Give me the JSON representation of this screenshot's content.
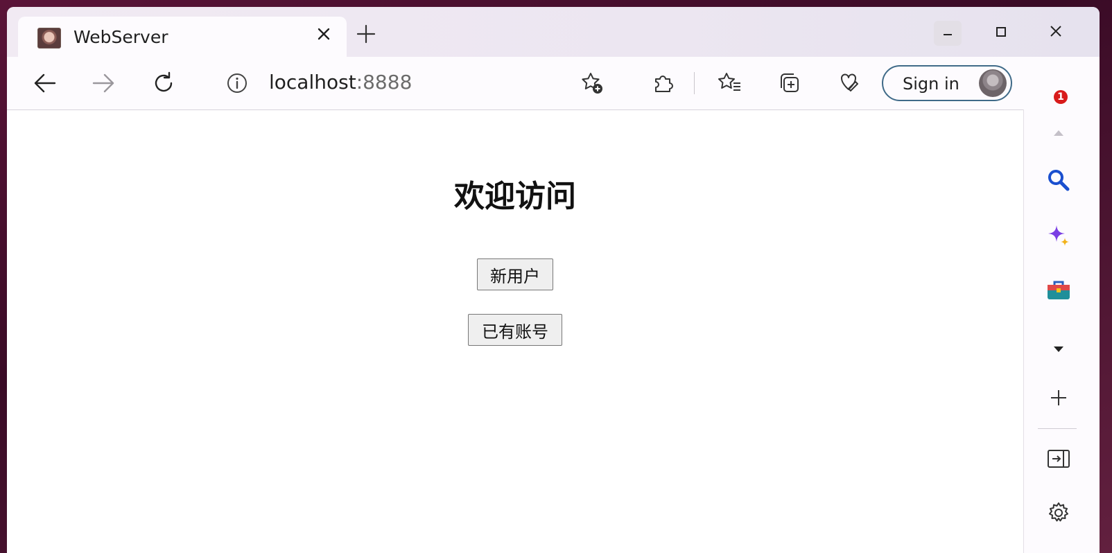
{
  "browser": {
    "tab_title": "WebServer",
    "address_host": "localhost",
    "address_port": ":8888",
    "signin_label": "Sign in",
    "notification_count": "1"
  },
  "page": {
    "title": "欢迎访问",
    "new_user_label": "新用户",
    "has_account_label": "已有账号"
  },
  "icons": {
    "back": "arrow-left-icon",
    "forward": "arrow-right-icon",
    "refresh": "refresh-icon",
    "info": "info-icon",
    "favorite_add": "star-plus-icon",
    "extensions": "puzzle-icon",
    "favorites": "favorites-icon",
    "collections": "collections-icon",
    "browser_essentials": "heart-shield-icon",
    "more": "more-icon",
    "search": "search-icon",
    "copilot": "sparkle-icon",
    "tools": "briefcase-icon",
    "add": "plus-icon",
    "split": "split-screen-icon",
    "settings": "gear-icon"
  },
  "colors": {
    "signin_border": "#3f6a88",
    "badge": "#d81b1b",
    "search_blue": "#1a4fcf",
    "copilot_purple": "#7b3fe4"
  }
}
